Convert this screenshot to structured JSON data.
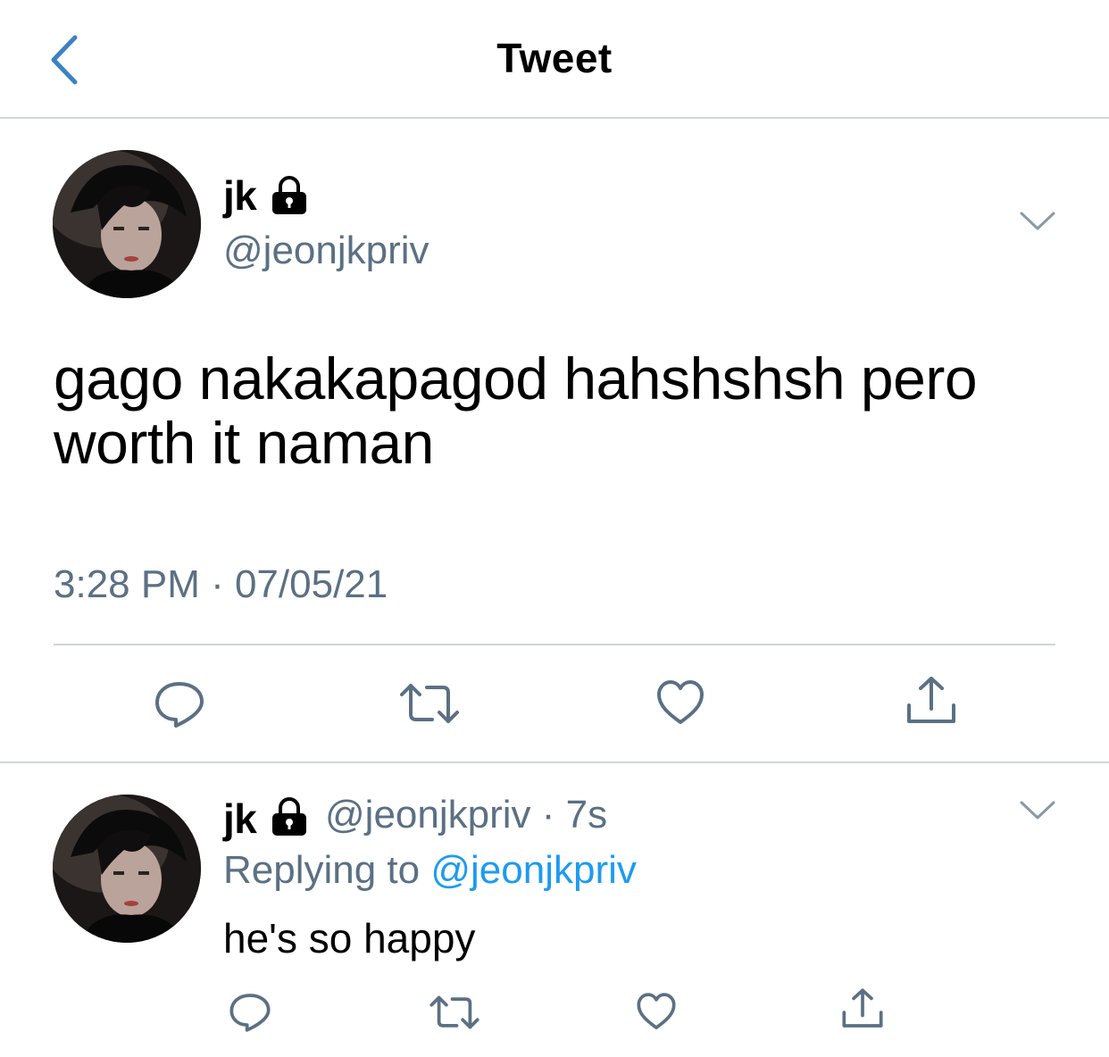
{
  "header": {
    "title": "Tweet",
    "back_icon": "chevron-left-icon",
    "accent_color": "#3b82c4"
  },
  "main_tweet": {
    "display_name": "jk",
    "handle": "@jeonjkpriv",
    "protected_icon": "lock-icon",
    "text_lines": [
      "gago nakakapagod hahshshsh pero",
      "worth it naman"
    ],
    "timestamp": "3:28 PM · 07/05/21",
    "actions": [
      "reply-icon",
      "retweet-icon",
      "like-icon",
      "share-icon"
    ]
  },
  "reply": {
    "display_name": "jk",
    "handle_time": "@jeonjkpriv · 7s",
    "replying_prefix": "Replying to ",
    "replying_mention": "@jeonjkpriv",
    "text": "he's so happy",
    "actions": [
      "reply-icon",
      "retweet-icon",
      "like-icon",
      "share-icon"
    ]
  },
  "colors": {
    "secondary_text": "#5b7083",
    "mention": "#1d9bf0",
    "divider": "#cfd5da",
    "icon_stroke": "#5b7083"
  }
}
